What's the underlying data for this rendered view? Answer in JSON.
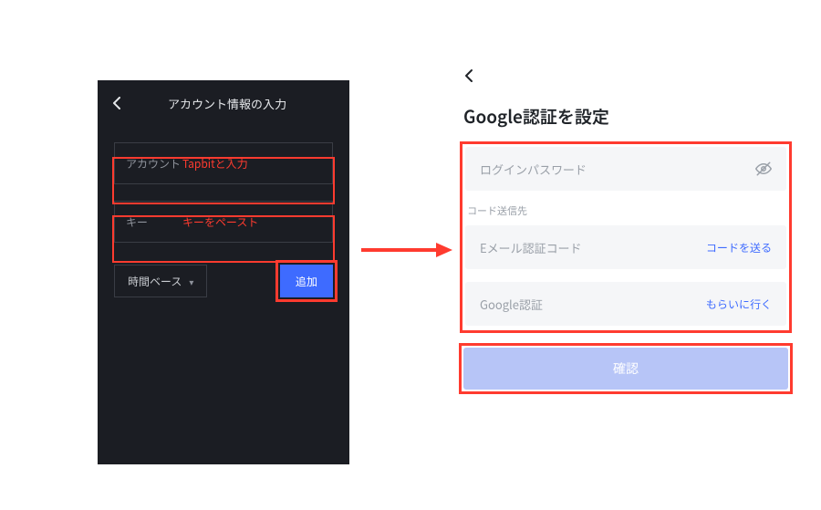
{
  "left": {
    "header_title": "アカウント情報の入力",
    "account_label": "アカウント",
    "account_value": "Tapbitと入力",
    "key_label": "キー",
    "key_value": "キーをペースト",
    "time_base_label": "時間ベース",
    "add_label": "追加"
  },
  "right": {
    "title": "Google認証を設定",
    "password_placeholder": "ログインパスワード",
    "code_section_label": "コード送信先",
    "email_code_placeholder": "Eメール認証コード",
    "send_code_label": "コードを送る",
    "google_auth_placeholder": "Google認証",
    "get_code_label": "もらいに行く",
    "confirm_label": "確認"
  },
  "colors": {
    "highlight": "#ff3b2f",
    "primary_blue": "#3e6bff",
    "confirm_disabled": "#b7c5f7",
    "dark_bg": "#1b1d23",
    "light_field": "#f5f6f8"
  }
}
